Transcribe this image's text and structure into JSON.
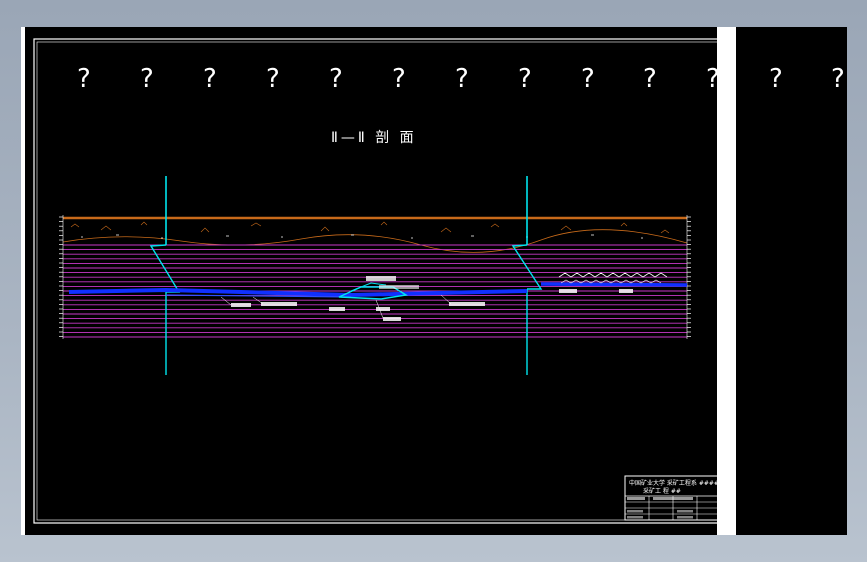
{
  "placeholder_glyphs": [
    "?",
    "?",
    "?",
    "?",
    "?",
    "?",
    "?",
    "?",
    "?",
    "?",
    "?",
    "?",
    "?"
  ],
  "section_title": "Ⅱ—Ⅱ 剖 面",
  "colors": {
    "background": "#000000",
    "border": "#ffffff",
    "cyan_lines": "#00e5ee",
    "strata_lines": "#d040d0",
    "soil_layer": "#c86a1a",
    "water_line": "#1030ff"
  },
  "title_block": {
    "line1": "中国矿业大学 采矿工程系 ####",
    "line2": "采矿工 程 ##"
  }
}
